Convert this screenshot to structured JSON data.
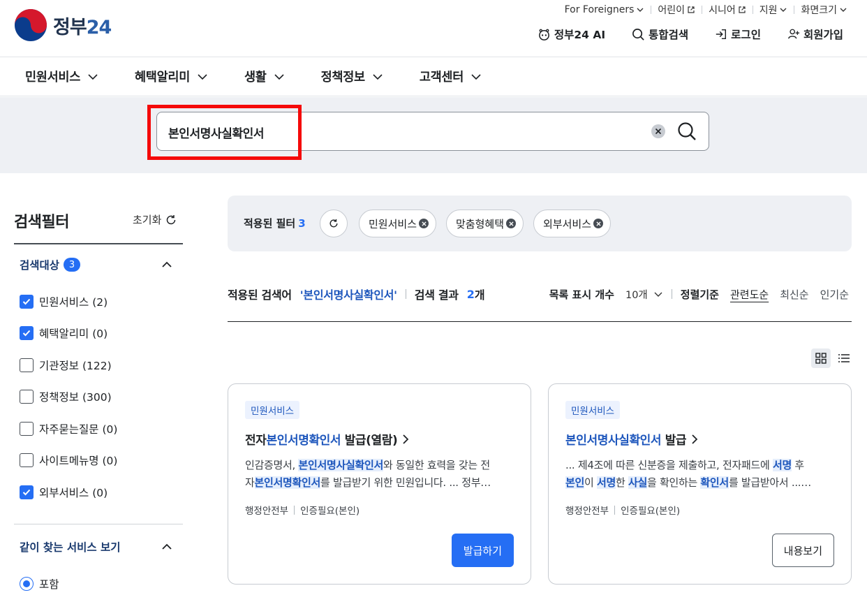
{
  "header": {
    "logo_text": "정부",
    "logo_num": "24",
    "util": {
      "foreigners": "For Foreigners",
      "kids": "어린이",
      "senior": "시니어",
      "region": "지원",
      "screen_size": "화면크기"
    },
    "main": {
      "ai": "정부24 AI",
      "search": "통합검색",
      "login": "로그인",
      "signup": "회원가입"
    }
  },
  "gnb": {
    "items": [
      {
        "label": "민원서비스"
      },
      {
        "label": "혜택알리미"
      },
      {
        "label": "생활"
      },
      {
        "label": "정책정보"
      },
      {
        "label": "고객센터"
      }
    ]
  },
  "search": {
    "value": "본인서명사실확인서"
  },
  "filter": {
    "title": "검색필터",
    "reset": "초기화",
    "target": {
      "title": "검색대상",
      "count": "3",
      "items": [
        {
          "label": "민원서비스 (2)",
          "checked": true
        },
        {
          "label": "혜택알리미 (0)",
          "checked": true
        },
        {
          "label": "기관정보 (122)",
          "checked": false
        },
        {
          "label": "정책정보 (300)",
          "checked": false
        },
        {
          "label": "자주묻는질문 (0)",
          "checked": false
        },
        {
          "label": "사이트메뉴명 (0)",
          "checked": false
        },
        {
          "label": "외부서비스 (0)",
          "checked": true
        }
      ]
    },
    "related": {
      "title": "같이 찾는 서비스 보기",
      "option": "포함"
    }
  },
  "applied": {
    "label": "적용된 필터",
    "count": "3",
    "chips": [
      "민원서비스",
      "맞춤형혜택",
      "외부서비스"
    ]
  },
  "results": {
    "term_label": "적용된 검색어",
    "term": "'본인서명사실확인서'",
    "count_label": "검색 결과",
    "count": "2",
    "count_unit": "개",
    "rows_label": "목록 표시 개수",
    "rows_value": "10개",
    "sort_label": "정렬기준",
    "sort_options": [
      "관련도순",
      "최신순",
      "인기순"
    ]
  },
  "cards": [
    {
      "badge": "민원서비스",
      "title_pre": "전자",
      "title_hl": "본인서명확인서",
      "title_post": " 발급(열람)",
      "desc1_a": "인감증명서, ",
      "desc1_b": "본인서명사실확인서",
      "desc1_c": "와 동일한 효력을 갖는 전",
      "desc2_a": "자",
      "desc2_b": "본인서명확인서",
      "desc2_c": "를 발급받기 위한 민원입니다. ... 정부…",
      "org": "행정안전부",
      "auth": "인증필요(본인)",
      "button": "발급하기"
    },
    {
      "badge": "민원서비스",
      "title_pre": "",
      "title_hl": "본인서명사실확인서",
      "title_post": " 발급",
      "desc1_a": "... 제4조에 따른 신분증을 제출하고, 전자패드에 ",
      "desc1_b": "서명",
      "desc1_c": " 후",
      "desc2_b1": "본인",
      "desc2_a": "이 ",
      "desc2_b2": "서명",
      "desc2_c": "한 ",
      "desc2_b3": "사실",
      "desc2_d": "을 확인하는 ",
      "desc2_b4": "확인서",
      "desc2_e": "를 발급받아서 ...…",
      "org": "행정안전부",
      "auth": "인증필요(본인)",
      "button": "내용보기"
    }
  ],
  "colors": {
    "primary": "#256ef4",
    "highlight_text": "#1d56bc",
    "annotation_red": "#f50a0a",
    "band_bg": "#eef0f4"
  }
}
